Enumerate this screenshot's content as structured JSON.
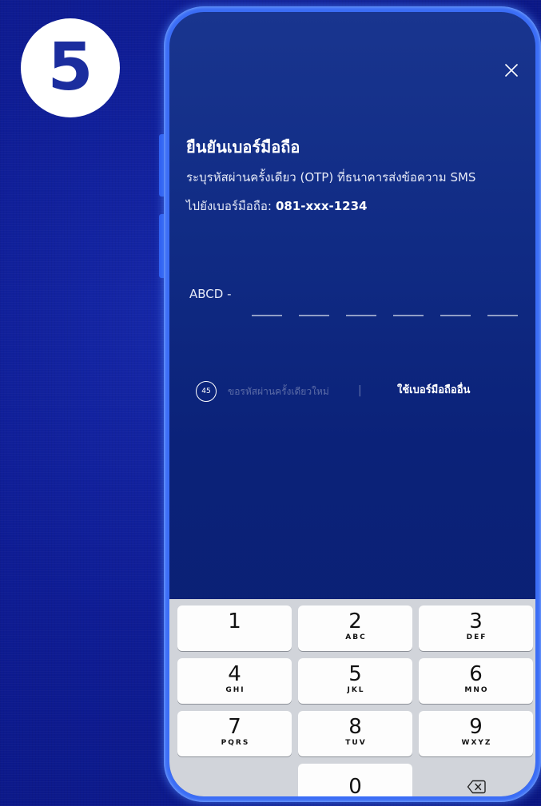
{
  "step_badge": {
    "number": "5"
  },
  "screen": {
    "title": "ยืนยันเบอร์มือถือ",
    "description": "ระบุรหัสผ่านครั้งเดียว (OTP) ที่ธนาคารส่งข้อความ SMS",
    "phone_label": "ไปยังเบอร์มือถือ:",
    "phone_number": "081-xxx-1234",
    "otp_prefix": "ABCD -",
    "resend": {
      "timer": "45",
      "label": "ขอรหัสผ่านครั้งเดียวใหม่",
      "divider": "|"
    },
    "other_number_label": "ใช้เบอร์มือถืออื่น"
  },
  "keypad": {
    "keys": [
      {
        "digit": "1"
      },
      {
        "digit": "2",
        "letters": "ABC"
      },
      {
        "digit": "3",
        "letters": "DEF"
      },
      {
        "digit": "4",
        "letters": "GHI"
      },
      {
        "digit": "5",
        "letters": "JKL"
      },
      {
        "digit": "6",
        "letters": "MNO"
      },
      {
        "digit": "7",
        "letters": "PQRS"
      },
      {
        "digit": "8",
        "letters": "TUV"
      },
      {
        "digit": "9",
        "letters": "WXYZ"
      },
      {
        "digit": "0"
      }
    ]
  },
  "icons": {
    "close": "close-icon",
    "backspace": "backspace-icon",
    "timer": "countdown-ring-icon"
  },
  "colors": {
    "background": "#0c1a8c",
    "phone_frame": "#3b6df6",
    "screen": "#0b2279",
    "keypad": "#d1d4da",
    "key": "#fdfdfd",
    "badge": "#ffffff",
    "badge_text": "#1b2d9e"
  }
}
